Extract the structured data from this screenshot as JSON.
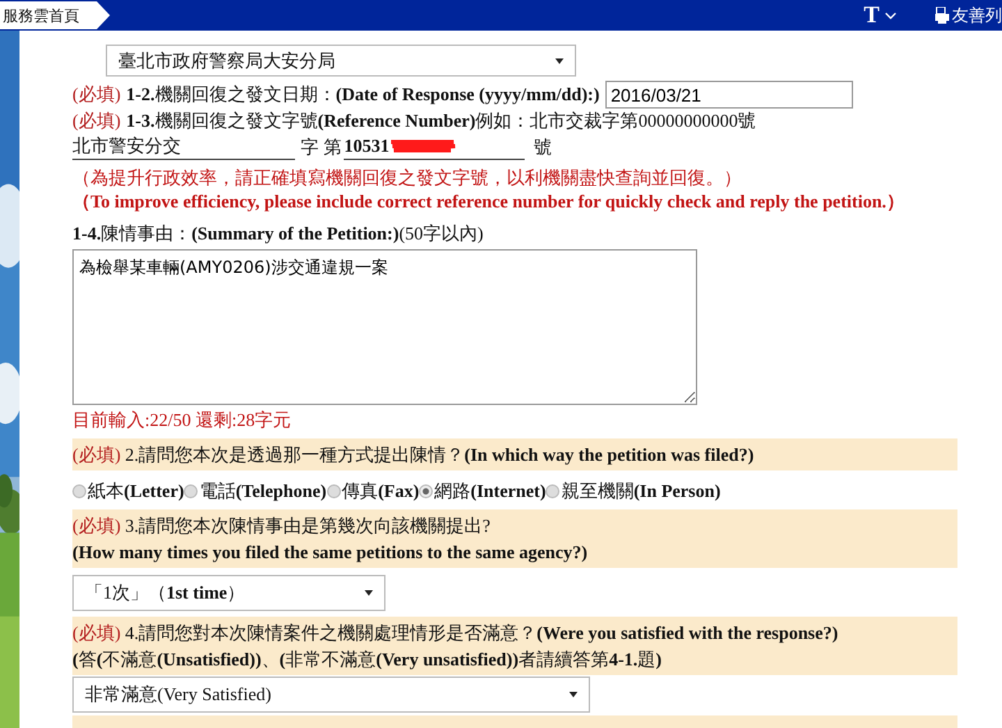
{
  "top_bar": {
    "home_tab": "服務雲首頁",
    "font_size_button": "T",
    "accessibility_link": "友善列"
  },
  "agency_select": {
    "value": "臺北市政府警察局大安分局"
  },
  "response_date": {
    "required": "(必填)",
    "label": "**1-2.**機關回復之發文日期：**(Date of Response (yyyy/mm/dd):)**",
    "value": "2016/03/21"
  },
  "reference": {
    "required": "(必填)",
    "label": "**1-3.**機關回復之發文字號**(Reference Number)**例如：北市交裁字第00000000000號",
    "prefix_value": "北市警安分交",
    "word_label": "字 第",
    "number_value": "10531",
    "redacted": true,
    "suffix": "號",
    "notice_zh": "（為提升行政效率，請正確填寫機關回復之發文字號，以利機關盡快查詢並回復。）",
    "notice_en": "（To improve efficiency, please include correct reference number for quickly check and reply the petition.）"
  },
  "summary": {
    "label": "**1-4.**陳情事由：**(Summary of the Petition:)**(50字以內)",
    "value": "為檢舉某車輛(AMY0206)涉交通違規一案",
    "counter": "目前輸入:22/50 還剩:28字元"
  },
  "questions": [
    {
      "kind": "radio",
      "required": "(必填)",
      "lines": [
        "2.請問您本次是透過那一種方式提出陳情？**(In which way the petition was filed?)**"
      ],
      "options": [
        {
          "label": "紙本**(Letter)**",
          "selected": false
        },
        {
          "label": "電話**(Telephone)**",
          "selected": false
        },
        {
          "label": "傳真**(Fax)**",
          "selected": false
        },
        {
          "label": "網路**(Internet)**",
          "selected": true
        },
        {
          "label": "親至機關**(In Person)**",
          "selected": false
        }
      ]
    },
    {
      "kind": "select",
      "required": "(必填)",
      "lines": [
        "3.請問您本次陳情事由是第幾次向該機關提出?",
        "**(How many times you filed the same petitions to the same agency?)**"
      ],
      "value": "「1次」（**1st time**）"
    },
    {
      "kind": "select",
      "required": "(必填)",
      "lines": [
        "4.請問您對本次陳情案件之機關處理情形是否滿意？**(Were you satisfied with the response?)**",
        "**(**答**(**不滿意**(Unsatisfied))**、**(**非常不滿意**(Very unsatisfied))**者請續答第**4-1.**題**)**"
      ],
      "value": "非常滿意(Very Satisfied)"
    }
  ]
}
